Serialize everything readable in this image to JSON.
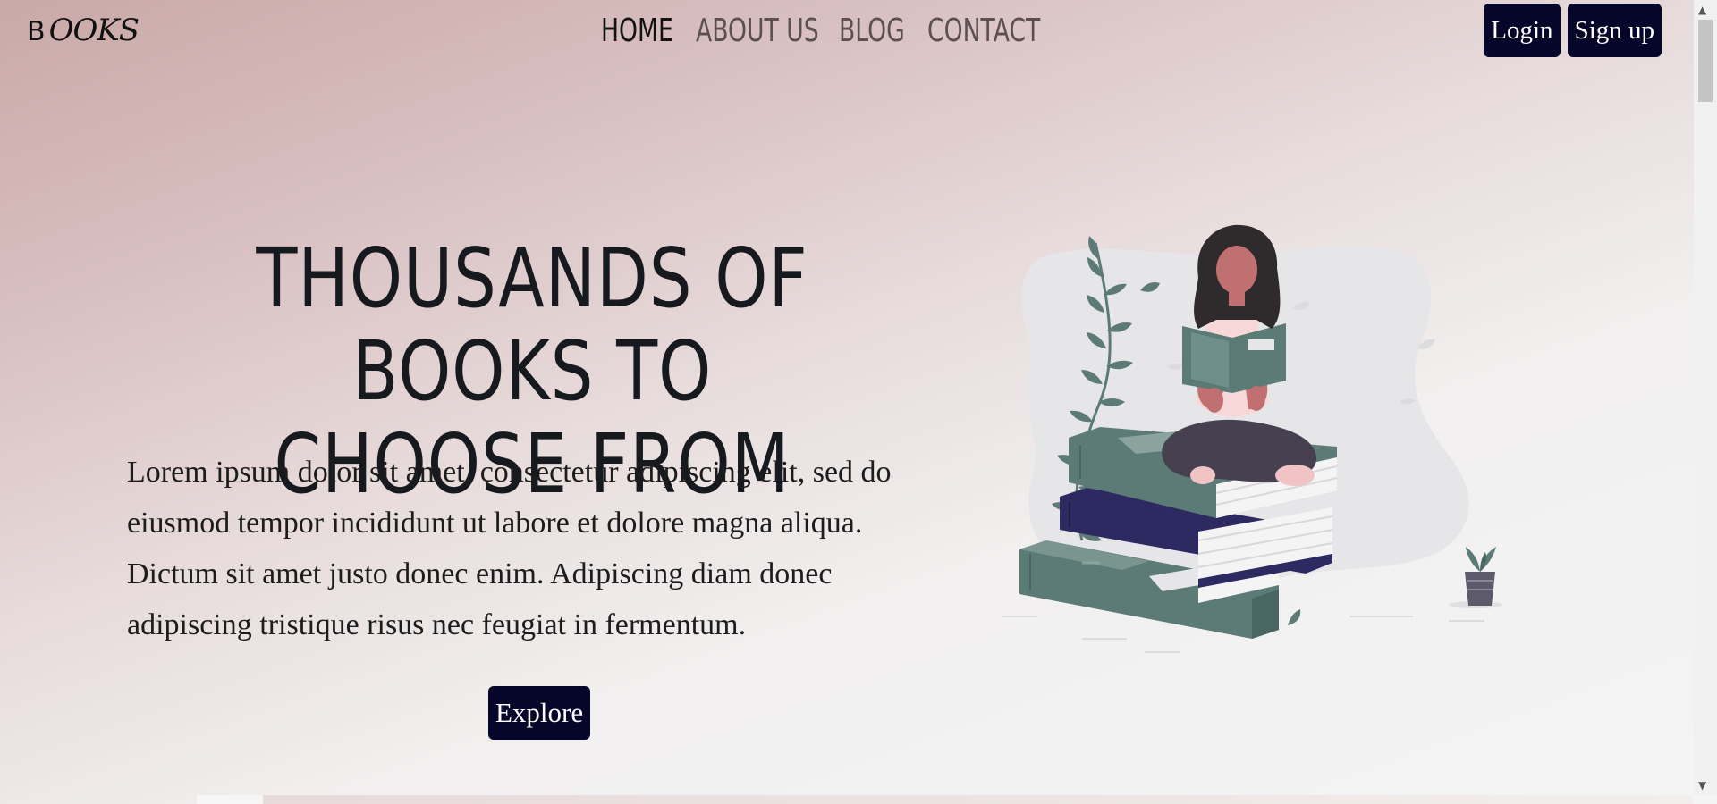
{
  "logo": {
    "first_letter": "B",
    "rest": "OOKS"
  },
  "nav": {
    "items": [
      {
        "label": "HOME",
        "active": true
      },
      {
        "label": "ABOUT US",
        "active": false
      },
      {
        "label": "BLOG",
        "active": false
      },
      {
        "label": "CONTACT",
        "active": false
      }
    ]
  },
  "auth": {
    "login_label": "Login",
    "signup_label": "Sign up"
  },
  "hero": {
    "title_line1": "THOUSANDS OF BOOKS TO",
    "title_line2": "CHOOSE FROM",
    "text": "Lorem ipsum dolor sit amet, consectetur adipiscing elit, sed do eiusmod tempor incididunt ut labore et dolore magna aliqua. Dictum sit amet justo donec enim. Adipiscing diam donec adipiscing tristique risus nec feugiat in fermentum.",
    "cta_label": "Explore"
  },
  "illustration": {
    "icon": "woman-reading-on-books-illustration"
  },
  "colors": {
    "button_bg": "#06062a",
    "button_text": "#ffffff",
    "book_green": "#5c7b77",
    "book_navy": "#2d2a61",
    "nav_inactive": "#5b4f4f"
  }
}
